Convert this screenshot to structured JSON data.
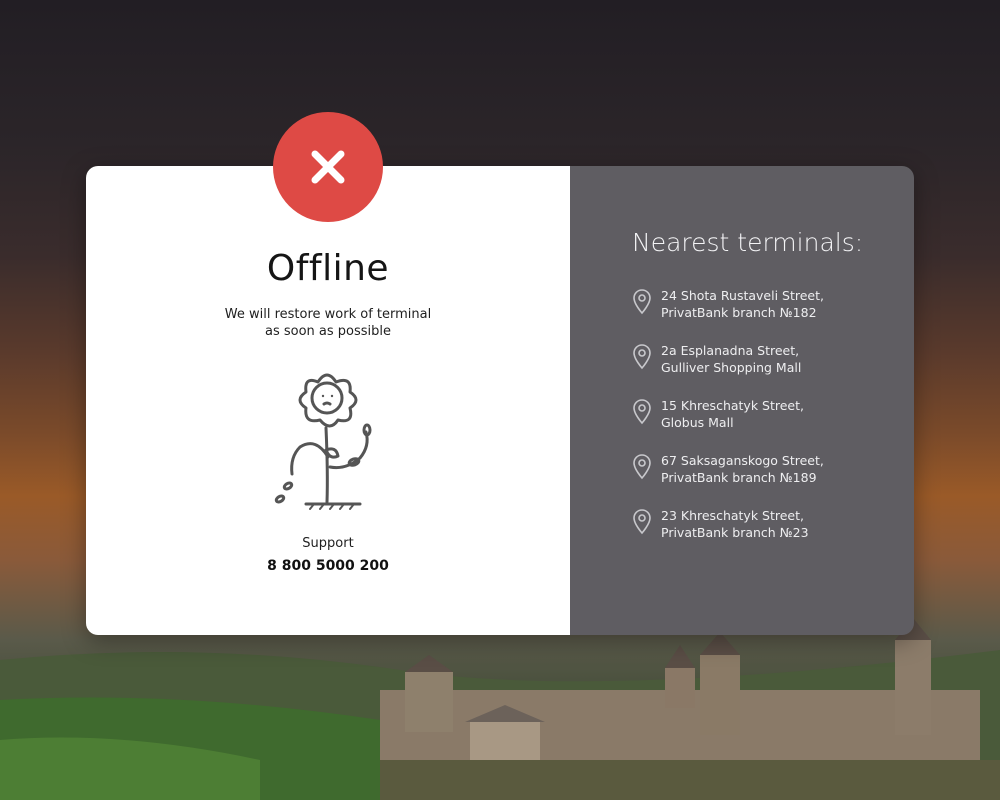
{
  "status": {
    "title": "Offline",
    "message_line1": "We will restore work of terminal",
    "message_line2": "as soon as possible",
    "badge_icon": "close-icon",
    "badge_color": "#de4a45"
  },
  "support": {
    "label": "Support",
    "phone": "8 800 5000 200"
  },
  "panel": {
    "title": "Nearest terminals:",
    "background": "#5f5d62",
    "terminals": [
      {
        "line1": "24 Shota Rustaveli Street,",
        "line2": "PrivatBank branch №182",
        "icon": "location-pin-icon"
      },
      {
        "line1": "2a Esplanadna Street,",
        "line2": "Gulliver Shopping Mall",
        "icon": "location-pin-icon"
      },
      {
        "line1": "15 Khreschatyk Street,",
        "line2": "Globus Mall",
        "icon": "location-pin-icon"
      },
      {
        "line1": "67 Saksaganskogo Street,",
        "line2": "PrivatBank branch №189",
        "icon": "location-pin-icon"
      },
      {
        "line1": "23 Khreschatyk Street,",
        "line2": "PrivatBank branch №23",
        "icon": "location-pin-icon"
      }
    ]
  }
}
